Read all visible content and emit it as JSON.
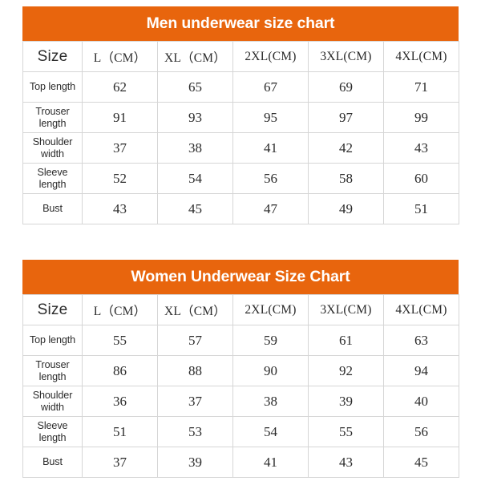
{
  "theme": {
    "banner_color": "#e8650d",
    "banner_text_color": "#ffffff",
    "page_background": "#ffffff",
    "grid_border_color": "#d6d6d6",
    "text_color": "#2b2b2b"
  },
  "charts": [
    {
      "id": "men",
      "title": "Men underwear size chart",
      "size_label": "Size",
      "columns": [
        "L（CM）",
        "XL（CM）",
        "2XL(CM)",
        "3XL(CM)",
        "4XL(CM)"
      ],
      "rows": [
        {
          "label_lines": [
            "Top length"
          ],
          "values": [
            "62",
            "65",
            "67",
            "69",
            "71"
          ]
        },
        {
          "label_lines": [
            "Trouser",
            "length"
          ],
          "values": [
            "91",
            "93",
            "95",
            "97",
            "99"
          ]
        },
        {
          "label_lines": [
            "Shoulder",
            "width"
          ],
          "values": [
            "37",
            "38",
            "41",
            "42",
            "43"
          ]
        },
        {
          "label_lines": [
            "Sleeve",
            "length"
          ],
          "values": [
            "52",
            "54",
            "56",
            "58",
            "60"
          ]
        },
        {
          "label_lines": [
            "Bust"
          ],
          "values": [
            "43",
            "45",
            "47",
            "49",
            "51"
          ]
        }
      ]
    },
    {
      "id": "women",
      "title": "Women Underwear Size Chart",
      "size_label": "Size",
      "columns": [
        "L（CM）",
        "XL（CM）",
        "2XL(CM)",
        "3XL(CM)",
        "4XL(CM)"
      ],
      "rows": [
        {
          "label_lines": [
            "Top length"
          ],
          "values": [
            "55",
            "57",
            "59",
            "61",
            "63"
          ]
        },
        {
          "label_lines": [
            "Trouser",
            "length"
          ],
          "values": [
            "86",
            "88",
            "90",
            "92",
            "94"
          ]
        },
        {
          "label_lines": [
            "Shoulder",
            "width"
          ],
          "values": [
            "36",
            "37",
            "38",
            "39",
            "40"
          ]
        },
        {
          "label_lines": [
            "Sleeve",
            "length"
          ],
          "values": [
            "51",
            "53",
            "54",
            "55",
            "56"
          ]
        },
        {
          "label_lines": [
            "Bust"
          ],
          "values": [
            "37",
            "39",
            "41",
            "43",
            "45"
          ]
        }
      ]
    }
  ],
  "chart_data": {
    "type": "table",
    "title": "Underwear size charts (Men and Women)",
    "tables": [
      {
        "title": "Men underwear size chart",
        "row_header": "Size",
        "columns": [
          "L（CM）",
          "XL（CM）",
          "2XL(CM)",
          "3XL(CM)",
          "4XL(CM)"
        ],
        "measurements": [
          "Top length",
          "Trouser length",
          "Shoulder width",
          "Sleeve length",
          "Bust"
        ],
        "values": [
          [
            62,
            65,
            67,
            69,
            71
          ],
          [
            91,
            93,
            95,
            97,
            99
          ],
          [
            37,
            38,
            41,
            42,
            43
          ],
          [
            52,
            54,
            56,
            58,
            60
          ],
          [
            43,
            45,
            47,
            49,
            51
          ]
        ],
        "unit": "CM"
      },
      {
        "title": "Women Underwear Size Chart",
        "row_header": "Size",
        "columns": [
          "L（CM）",
          "XL（CM）",
          "2XL(CM)",
          "3XL(CM)",
          "4XL(CM)"
        ],
        "measurements": [
          "Top length",
          "Trouser length",
          "Shoulder width",
          "Sleeve length",
          "Bust"
        ],
        "values": [
          [
            55,
            57,
            59,
            61,
            63
          ],
          [
            86,
            88,
            90,
            92,
            94
          ],
          [
            36,
            37,
            38,
            39,
            40
          ],
          [
            51,
            53,
            54,
            55,
            56
          ],
          [
            37,
            39,
            41,
            43,
            45
          ]
        ],
        "unit": "CM"
      }
    ]
  }
}
